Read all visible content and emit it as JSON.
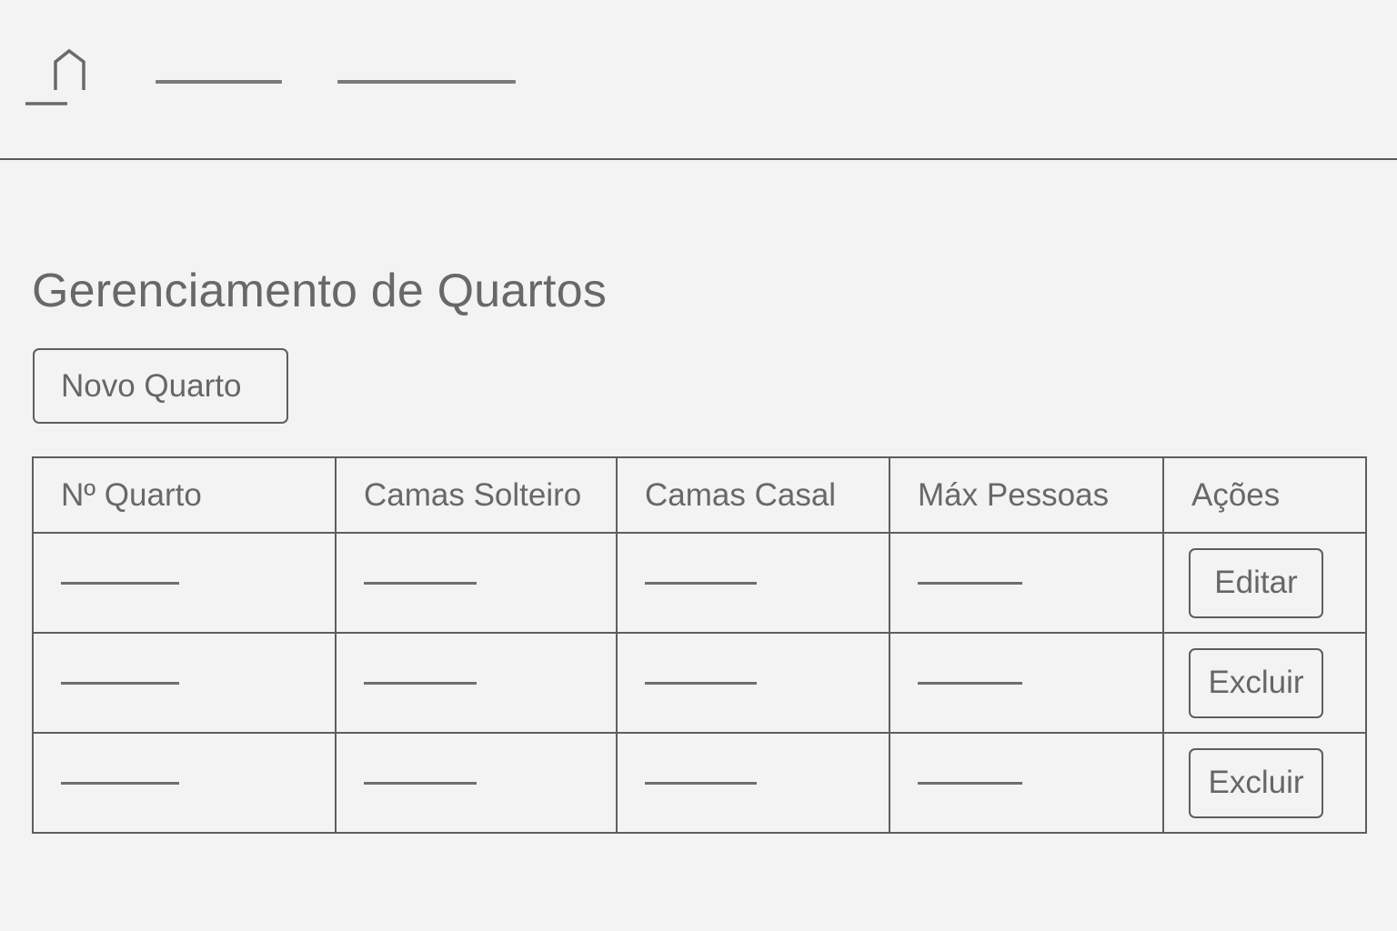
{
  "nav": {
    "home_icon": "home-icon",
    "links": [
      "",
      ""
    ]
  },
  "page": {
    "title": "Gerenciamento de Quartos",
    "new_room_label": "Novo Quarto"
  },
  "table": {
    "columns": [
      "Nº Quarto",
      "Camas Solteiro",
      "Camas Casal",
      "Máx Pessoas",
      "Ações"
    ],
    "rows": [
      {
        "cells": [
          "",
          "",
          "",
          ""
        ],
        "action": "Editar"
      },
      {
        "cells": [
          "",
          "",
          "",
          ""
        ],
        "action": "Excluir"
      },
      {
        "cells": [
          "",
          "",
          "",
          ""
        ],
        "action": "Excluir"
      }
    ]
  },
  "colors": {
    "background": "#f3f3f3",
    "line": "#5e5e5e",
    "text": "#686868"
  }
}
